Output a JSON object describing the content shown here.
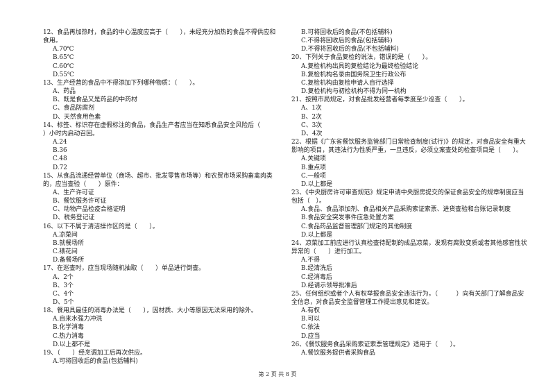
{
  "columns": [
    {
      "items": [
        {
          "stem": "12、食品再加热时，食品的中心温度应高于（　　），未经充分加热的食品不得供应和食用。",
          "options": [
            "A.70℃",
            "B.65℃",
            "C.60℃",
            "D.55℃"
          ]
        },
        {
          "stem": "13、生产经营的食品中不得添加下列哪种物质：（　　）。",
          "options": [
            "A、药品",
            "B、既是食品又是药品的中药材",
            "C、食品防腐剂",
            "D、天然食用色素"
          ]
        },
        {
          "stem": "14、标签、标识存在虚假标注的食品，食品生产者应当在知悉食品安全风险后（　　　）小时内启动召回。",
          "options": [
            "A.24",
            "B.36",
            "C.48",
            "D.72"
          ]
        },
        {
          "stem": "15、从食品流通经营单位（商场、超市、批发零售市场等）和农贸市场采购畜禽肉类的，应当查验（　　）原件：",
          "options": [
            "A、生产许可证",
            "B、餐饮服务许可证",
            "C、动物产品检疫合格证明",
            "D、税务登记证"
          ]
        },
        {
          "stem": "16、以下不属于清洁操作区的是（　　）。",
          "options": [
            "A.凉菜间",
            "B.就餐场所",
            "C.裱花间",
            "D.备餐场所"
          ]
        },
        {
          "stem": "17、在巡查时，应当现场随机抽取（　　）单品进行倒查。",
          "options": [
            "A、2个",
            "B、3个",
            "C、4个",
            "D、5个"
          ]
        },
        {
          "stem": "18、餐用具最佳的消毒办法是（　　），因材质、大小等原因无法采用的除外。",
          "options": [
            "A.自来水强力冲洗",
            "B.化学消毒",
            "C.热力消毒",
            "D.以上都不是"
          ]
        },
        {
          "stem": "19、（　　）经烹调加工后再次供应。",
          "options": [
            "A.可将回收后的食品(包括辅料)"
          ]
        }
      ]
    },
    {
      "items": [
        {
          "stem": "",
          "options": [
            "B.可将回收后的食品(不包括辅料)",
            "C.不得将回收后的食品(包括辅料)",
            "D.不得将回收后的食品(不包括辅料)"
          ]
        },
        {
          "stem": "20、下列关于食品复检的说法，错误的是（　　）。",
          "options": [
            "A.复检机构出具的复检结论为最终检验结论",
            "B.复检机构名录由国务院卫生行政公布",
            "C.复检机构由复检申请人自行选择",
            "D.复检机构与初检机构不得为同一机构"
          ]
        },
        {
          "stem": "21、按照市局规定，对食品批发经营者每季度至少巡查（　　）。",
          "options": [
            "A、1次",
            "B、2次",
            "C、3次",
            "D、4次"
          ]
        },
        {
          "stem": "22、根据《广东省餐饮服务监管部门日常检查制度(试行)》的规定，对食品安全有重大影响的项目，其违法行为性质严重，一旦违反，必须立案查处的检查项目是（　　）。",
          "options": [
            "A.关键项",
            "B.重点项",
            "C.一般项",
            "D.以上都是"
          ]
        },
        {
          "stem": "23、《中央厨房许可审查规范》规定申请中央厨房提交的保证食品安全的规章制度应当包括（　）。",
          "options": [
            "A.食品、食品添加剂、食品相关产品采购索证索票、进货查验和台账记录制度",
            "B.食品安全突发事件应急处置方案",
            "C.食品药品监督管理部门规定的其他制度",
            "D.以上都是"
          ]
        },
        {
          "stem": "24、凉菜加工前应进行认真检查待配制的成品凉菜，发现有腐败变质或者其他感官性状异常的（　　）进行加工。",
          "options": [
            "A.不得",
            "B.经清洗后",
            "C.经消毒后",
            "D.经请示领导批准后"
          ]
        },
        {
          "stem": "25、任何组织或者个人有权举报食品安全违法行为，（　　　）向有关部门了解食品安全信息，对食品安全监督管理工作提出意见和建议。",
          "options": [
            "A.有权",
            "B.可以",
            "C.依法",
            "D.应当"
          ]
        },
        {
          "stem": "26、《餐饮服务食品采购索证索票管理规定》适用于（　　）。",
          "options": [
            "A.餐饮服务提供者采购食品"
          ]
        }
      ]
    }
  ],
  "footer": "第 2 页 共 8 页"
}
